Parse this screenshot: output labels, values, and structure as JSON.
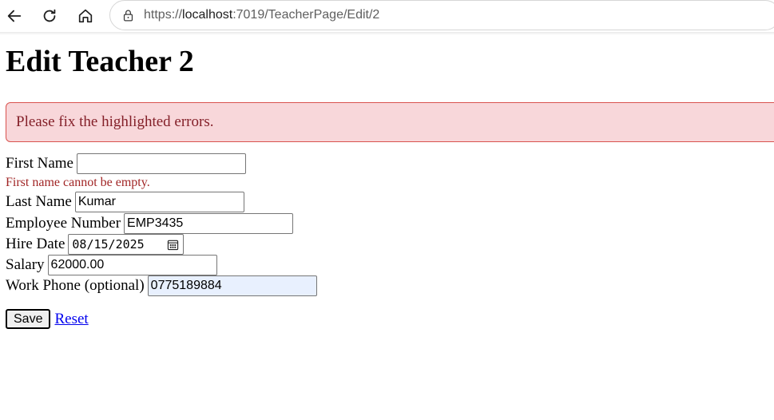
{
  "browser": {
    "url_prefix": "https://",
    "url_host": "localhost",
    "url_rest": ":7019/TeacherPage/Edit/2"
  },
  "page": {
    "title": "Edit Teacher 2",
    "alert_message": "Please fix the highlighted errors."
  },
  "form": {
    "first_name": {
      "label": "First Name",
      "value": "",
      "error": "First name cannot be empty."
    },
    "last_name": {
      "label": "Last Name",
      "value": "Kumar"
    },
    "employee_number": {
      "label": "Employee Number",
      "value": "EMP3435"
    },
    "hire_date": {
      "label": "Hire Date",
      "value": "08/15/2025"
    },
    "salary": {
      "label": "Salary",
      "value": "62000.00"
    },
    "work_phone": {
      "label": "Work Phone (optional)",
      "value": "0775189884"
    },
    "save_label": "Save",
    "reset_label": "Reset"
  },
  "icons": {
    "back": "back-arrow-icon",
    "refresh": "refresh-icon",
    "home": "home-icon",
    "site_info": "site-info-icon",
    "calendar": "calendar-icon"
  },
  "colors": {
    "alert_background": "#f8d7da",
    "alert_border": "#d9534f",
    "alert_text": "#842029",
    "error_text": "#a12626",
    "link": "#0000ee",
    "autofill_background": "#e8f0fe"
  }
}
